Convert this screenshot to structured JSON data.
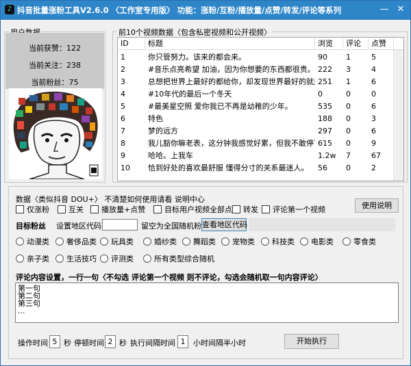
{
  "window": {
    "title": "抖音批量涨粉工具V2.6.0 〈工作室专用版〉 功能：涨粉/互粉/播放量/点赞/转发/评论等系列",
    "minimize": "—",
    "close": "✕"
  },
  "user_panel": {
    "legend": "用户数据",
    "likes_label": "当前获赞：",
    "likes_value": "122",
    "following_label": "当前关注：",
    "following_value": "238",
    "fans_label": "当前粉丝：",
    "fans_value": "75"
  },
  "videos_panel": {
    "legend": "前10个视频数据〈包含私密视频和公开视频〉",
    "columns": [
      "ID",
      "标题",
      "浏览",
      "评论",
      "点赞"
    ],
    "rows": [
      {
        "id": "1",
        "title": "你只管努力。该来的都会来。",
        "views": "90",
        "comments": "1",
        "likes": "5"
      },
      {
        "id": "2",
        "title": "#音乐点亮希望 加油，因为你想要的东西都很贵。",
        "views": "222",
        "comments": "3",
        "likes": "4"
      },
      {
        "id": "3",
        "title": "总想把世界上最好的都给你，却发现世界最好的就是…",
        "views": "251",
        "comments": "1",
        "likes": "6"
      },
      {
        "id": "4",
        "title": "#10年代的最后一个冬天",
        "views": "0",
        "comments": "0",
        "likes": "0"
      },
      {
        "id": "5",
        "title": "#最美星空照 爱你我已不再是幼稚的少年。",
        "views": "535",
        "comments": "0",
        "likes": "6"
      },
      {
        "id": "6",
        "title": "特色",
        "views": "188",
        "comments": "0",
        "likes": "3"
      },
      {
        "id": "7",
        "title": "梦的远方",
        "views": "297",
        "comments": "0",
        "likes": "6"
      },
      {
        "id": "8",
        "title": "我儿豁你嘛老表，这分钟我感觉好累，但我不敢停下…",
        "views": "615",
        "comments": "0",
        "likes": "9"
      },
      {
        "id": "9",
        "title": "哈哈。上我车",
        "views": "1.2w",
        "comments": "7",
        "likes": "67"
      },
      {
        "id": "10",
        "title": "恰到好处的喜欢最舒服  懂得分寸的关系最迷人。",
        "views": "56",
        "comments": "0",
        "likes": "2"
      }
    ]
  },
  "options": {
    "header_text": "数据〈类似抖音 DOU+〉  不清楚如何使用请看 说明中心",
    "checkboxes": [
      "仅涨粉",
      "互关",
      "播放量+点赞",
      "目标用户视频全部点赞",
      "转发",
      "评论第一个视频"
    ],
    "help_button": "使用说明"
  },
  "target": {
    "label": "目标粉丝",
    "region_label": "设置地区代码",
    "region_value": "",
    "hint": "留空为全国随机粉",
    "check_region_button": "查看地区代码",
    "categories_row1": [
      "动漫类",
      "奢侈品类",
      "玩具类",
      "婚纱类",
      "舞蹈类",
      "宠物类",
      "科技类",
      "电影类",
      "零食类"
    ],
    "categories_row2": [
      "亲子类",
      "生活技巧",
      "评测类",
      "所有类型综合随机"
    ]
  },
  "comments": {
    "label": "评论内容设置，一行一句〈不勾选 评论第一个视频 则不评论，勾选会随机取一句内容评论〉",
    "lines": [
      "第一句",
      "第二句",
      "第三句",
      "..."
    ]
  },
  "bottom": {
    "op_time_label": "操作时间",
    "op_time_value": "5",
    "op_time_unit": "秒",
    "pause_label": "停顿时间",
    "pause_value": "2",
    "pause_unit": "秒",
    "interval_label": "执行间隔时间",
    "interval_value": "1",
    "interval_unit": "小时间隔半小时",
    "start_button": "开始执行"
  }
}
